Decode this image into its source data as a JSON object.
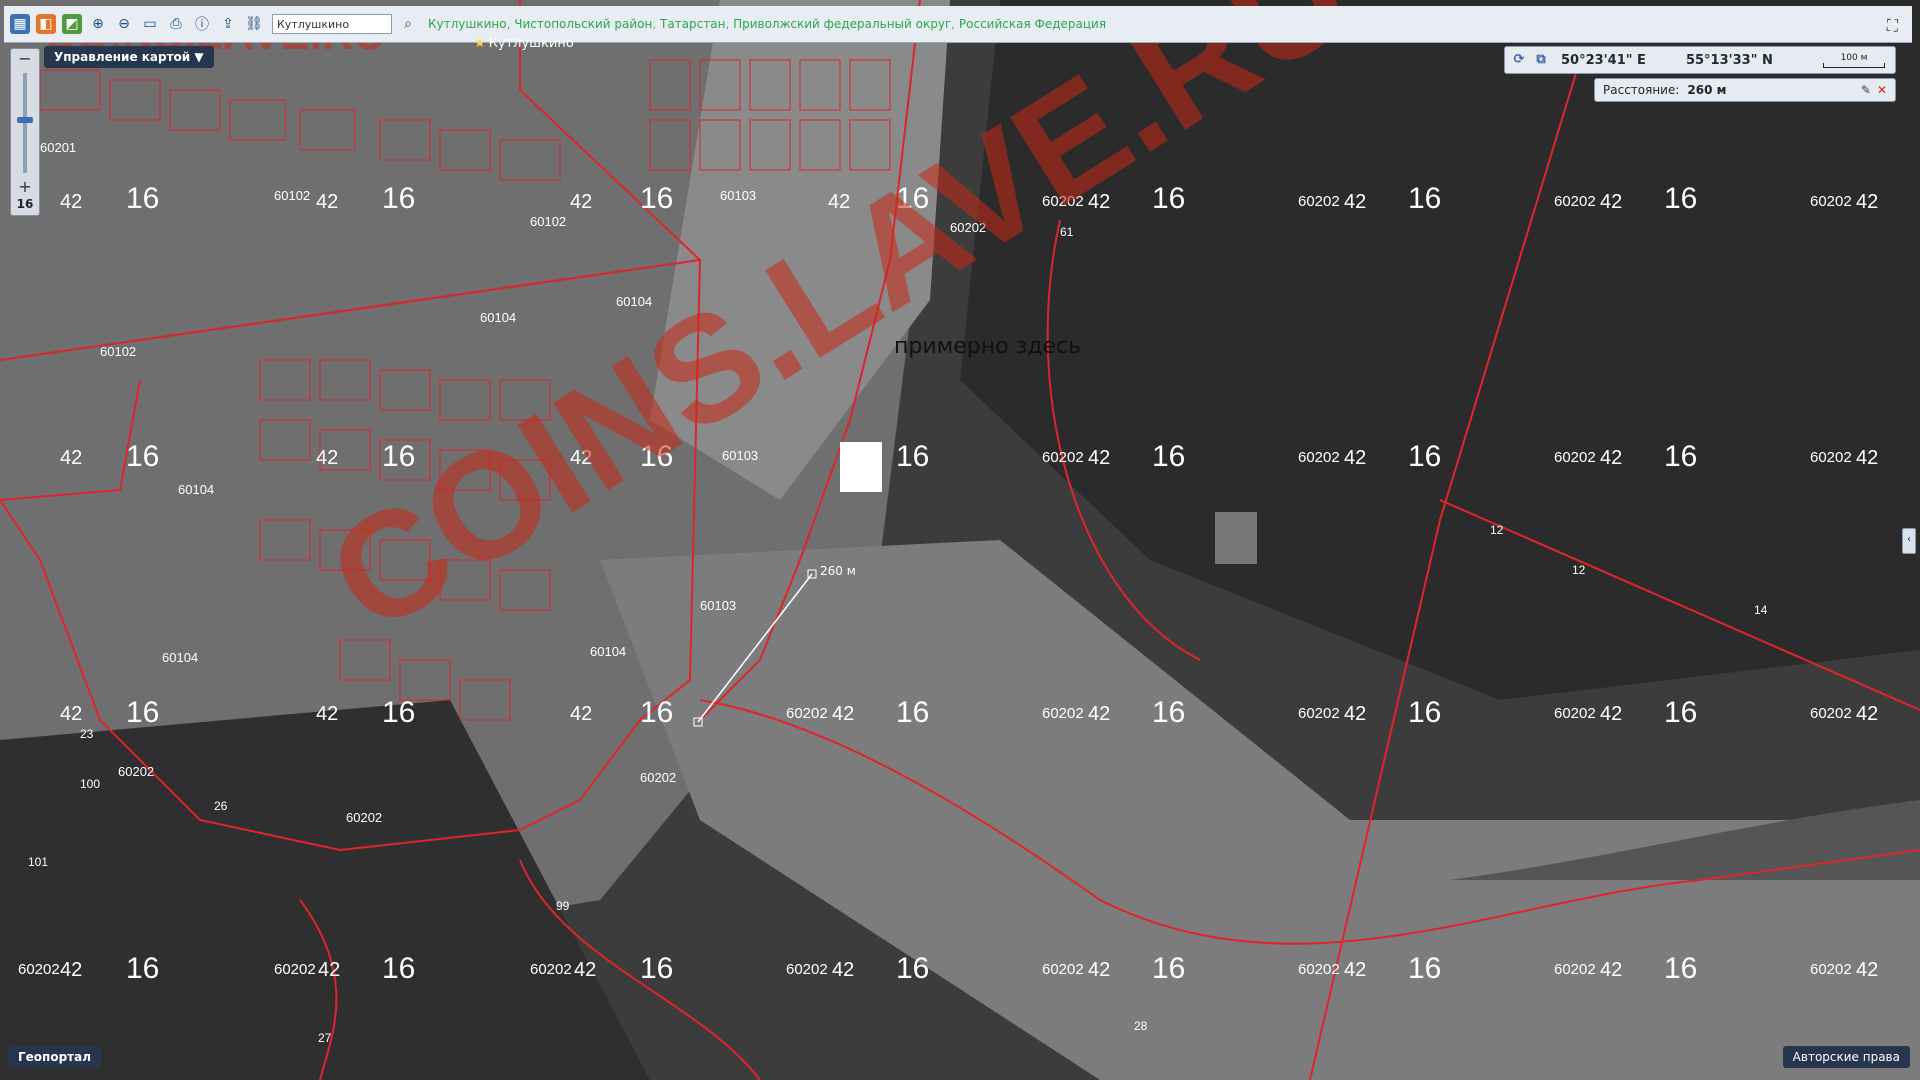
{
  "toolbar": {
    "search_value": "Кутлушкино",
    "breadcrumb": [
      "Кутлушкино",
      "Чистопольский район",
      "Татарстан",
      "Приволжский федеральный округ",
      "Российская Федерация"
    ]
  },
  "map_menu_label": "Управление картой ▼",
  "place_label": "Кутлушкино",
  "zoom_level": "16",
  "coords": {
    "lon": "50°23'41\" E",
    "lat": "55°13'33\" N",
    "scale": "100 м"
  },
  "distance": {
    "label": "Расстояние:",
    "value": "260 м"
  },
  "measure_label": "260 м",
  "annotation": "примерно здесь",
  "footer": {
    "left": "Геопортал",
    "right": "Авторские права"
  },
  "watermark": "COINS.LAVE.RU",
  "colors": {
    "boundary": "#e0242b",
    "label": "#ffffff",
    "accent": "#26364e"
  },
  "map_labels": [
    "16",
    "16",
    "16",
    "16",
    "16",
    "16",
    "16",
    "16",
    "16",
    "42",
    "42",
    "42",
    "42",
    "42",
    "42",
    "42",
    "42",
    "60202",
    "60202",
    "60202",
    "60202",
    "60202",
    "60202",
    "60202",
    "60104",
    "60104",
    "60104",
    "60104",
    "60103",
    "60103",
    "60102",
    "60102",
    "60201",
    "61",
    "61",
    "61",
    "12",
    "12",
    "14",
    "28",
    "99",
    "26",
    "27",
    "23",
    "100",
    "101"
  ]
}
